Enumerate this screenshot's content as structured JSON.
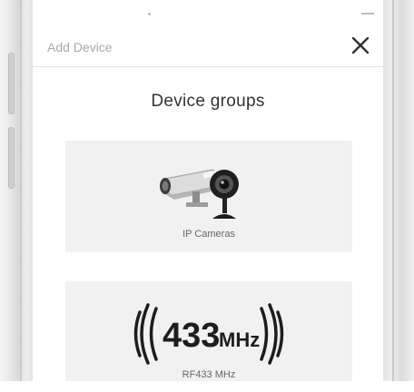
{
  "header": {
    "title": "Add Device",
    "close_icon": "close-icon"
  },
  "page_title": "Device groups",
  "groups": [
    {
      "label": "IP Cameras",
      "icon": "ip-camera-icon"
    },
    {
      "label": "RF433 MHz",
      "icon": "rf433-icon",
      "icon_number": "433",
      "icon_unit": "MHz"
    }
  ],
  "colors": {
    "card_background": "#f1f1f1",
    "title_text": "#333333",
    "muted_text": "#a9a9a9"
  }
}
